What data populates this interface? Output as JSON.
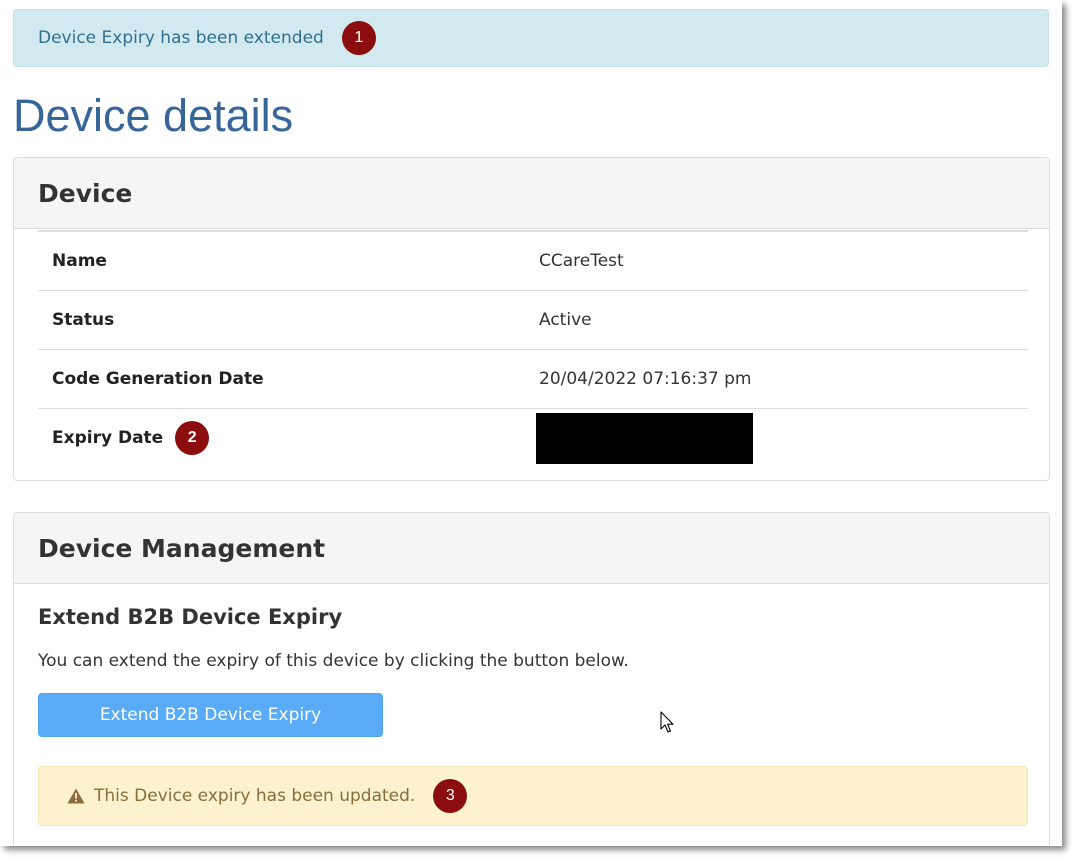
{
  "alert_info": {
    "text": "Device Expiry has been extended",
    "marker": "1"
  },
  "page_title": "Device details",
  "device_panel": {
    "heading": "Device",
    "rows": [
      {
        "label": "Name",
        "value": "CCareTest"
      },
      {
        "label": "Status",
        "value": "Active"
      },
      {
        "label": "Code Generation Date",
        "value": "20/04/2022 07:16:37 pm"
      },
      {
        "label": "Expiry Date",
        "marker": "2"
      }
    ]
  },
  "management_panel": {
    "heading": "Device Management",
    "sub_heading": "Extend B2B Device Expiry",
    "help_text": "You can extend the expiry of this device by clicking the button below.",
    "button_label": "Extend B2B Device Expiry"
  },
  "alert_warning": {
    "icon": "warning-icon",
    "text": "This Device expiry has been updated.",
    "marker": "3"
  },
  "colors": {
    "info_bg": "#d1e9ef",
    "info_text": "#31708f",
    "title": "#36659a",
    "button_bg": "#5aabf7",
    "warning_bg": "#fcf2cd",
    "warning_text": "#8a6d3b",
    "marker_bg": "#8b0d0d"
  }
}
